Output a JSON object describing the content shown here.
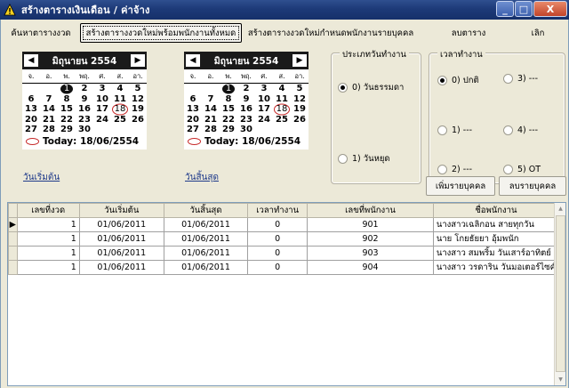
{
  "window": {
    "title": "สร้างตารางเงินเดือน / ค่าจ้าง",
    "controls": {
      "minimize": "_",
      "maximize": "□",
      "close": "X"
    }
  },
  "toolbar": {
    "search_schedule": "ค้นหาตารางงวด",
    "create_with_all_employees": "สร้างตารางงวดใหม่พร้อมพนักงานทั้งหมด",
    "create_with_specified_employees": "สร้างตารางงวดใหม่กำหนดพนักงานรายบุคคล",
    "delete_table": "ลบตาราง",
    "cancel": "เลิก"
  },
  "start_calendar": {
    "month_title": "มิถุนายน 2554",
    "prev": "◀",
    "next": "▶",
    "weekdays": [
      "จ.",
      "อ.",
      "พ.",
      "พฤ.",
      "ศ.",
      "ส.",
      "อา."
    ],
    "weeks": [
      [
        "",
        "",
        "",
        "1",
        "2",
        "3",
        "4",
        "5"
      ],
      [
        "6",
        "7",
        "8",
        "9",
        "10",
        "11",
        "12"
      ],
      [
        "13",
        "14",
        "15",
        "16",
        "17",
        "18",
        "19"
      ],
      [
        "20",
        "21",
        "22",
        "23",
        "24",
        "25",
        "26"
      ],
      [
        "27",
        "28",
        "29",
        "30",
        "",
        "",
        ""
      ]
    ],
    "selected": "1",
    "today_day": "18",
    "today_text": "Today: 18/06/2554",
    "label": "วันเริ่มต้น"
  },
  "end_calendar": {
    "month_title": "มิถุนายน 2554",
    "prev": "◀",
    "next": "▶",
    "weekdays": [
      "จ.",
      "อ.",
      "พ.",
      "พฤ.",
      "ศ.",
      "ส.",
      "อา."
    ],
    "selected": "1",
    "today_day": "18",
    "today_text": "Today: 18/06/2554",
    "label": "วันสิ้นสุด"
  },
  "workday_type": {
    "legend": "ประเภทวันทำงาน",
    "options": [
      {
        "label": "0) วันธรรมดา",
        "checked": true
      },
      {
        "label": "1) วันหยุด",
        "checked": false
      }
    ]
  },
  "work_time": {
    "legend": "เวลาทำงาน",
    "options": [
      {
        "label": "0) ปกติ",
        "checked": true
      },
      {
        "label": "1) ---",
        "checked": false
      },
      {
        "label": "2) ---",
        "checked": false
      },
      {
        "label": "3) ---",
        "checked": false
      },
      {
        "label": "4) ---",
        "checked": false
      },
      {
        "label": "5) OT",
        "checked": false
      }
    ]
  },
  "actions": {
    "add_person": "เพิ่มรายบุคคล",
    "remove_person": "ลบรายบุคคล"
  },
  "table": {
    "columns": [
      "เลขที่งวด",
      "วันเริ่มต้น",
      "วันสิ้นสุด",
      "เวลาทำงาน",
      "เลขที่พนักงาน",
      "ชื่อพนักงาน"
    ],
    "rows": [
      [
        "1",
        "01/06/2011",
        "01/06/2011",
        "0",
        "901",
        "นางสาวเฉลิกอน สายทุกวัน"
      ],
      [
        "1",
        "01/06/2011",
        "01/06/2011",
        "0",
        "902",
        "นาย โกยธัยยา อุ้มพนัก"
      ],
      [
        "1",
        "01/06/2011",
        "01/06/2011",
        "0",
        "903",
        "นางสาว สมพริ้ม วันเสาร์อาทิตย์"
      ],
      [
        "1",
        "01/06/2011",
        "01/06/2011",
        "0",
        "904",
        "นางสาว วรดาริน วันมอเตอร์ไซค์"
      ]
    ],
    "current_row_marker": "▶"
  }
}
